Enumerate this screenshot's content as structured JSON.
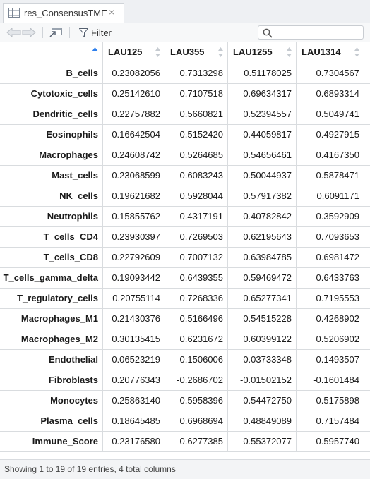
{
  "tab": {
    "title": "res_ConsensusTME",
    "close_glyph": "×"
  },
  "toolbar": {
    "filter_label": "Filter",
    "search_placeholder": ""
  },
  "table": {
    "columns": [
      "LAU125",
      "LAU355",
      "LAU1255",
      "LAU1314"
    ],
    "rows": [
      {
        "name": "B_cells",
        "values": [
          "0.23082056",
          "0.7313298",
          "0.51178025",
          "0.7304567"
        ]
      },
      {
        "name": "Cytotoxic_cells",
        "values": [
          "0.25142610",
          "0.7107518",
          "0.69634317",
          "0.6893314"
        ]
      },
      {
        "name": "Dendritic_cells",
        "values": [
          "0.22757882",
          "0.5660821",
          "0.52394557",
          "0.5049741"
        ]
      },
      {
        "name": "Eosinophils",
        "values": [
          "0.16642504",
          "0.5152420",
          "0.44059817",
          "0.4927915"
        ]
      },
      {
        "name": "Macrophages",
        "values": [
          "0.24608742",
          "0.5264685",
          "0.54656461",
          "0.4167350"
        ]
      },
      {
        "name": "Mast_cells",
        "values": [
          "0.23068599",
          "0.6083243",
          "0.50044937",
          "0.5878471"
        ]
      },
      {
        "name": "NK_cells",
        "values": [
          "0.19621682",
          "0.5928044",
          "0.57917382",
          "0.6091171"
        ]
      },
      {
        "name": "Neutrophils",
        "values": [
          "0.15855762",
          "0.4317191",
          "0.40782842",
          "0.3592909"
        ]
      },
      {
        "name": "T_cells_CD4",
        "values": [
          "0.23930397",
          "0.7269503",
          "0.62195643",
          "0.7093653"
        ]
      },
      {
        "name": "T_cells_CD8",
        "values": [
          "0.22792609",
          "0.7007132",
          "0.63984785",
          "0.6981472"
        ]
      },
      {
        "name": "T_cells_gamma_delta",
        "values": [
          "0.19093442",
          "0.6439355",
          "0.59469472",
          "0.6433763"
        ]
      },
      {
        "name": "T_regulatory_cells",
        "values": [
          "0.20755114",
          "0.7268336",
          "0.65277341",
          "0.7195553"
        ]
      },
      {
        "name": "Macrophages_M1",
        "values": [
          "0.21430376",
          "0.5166496",
          "0.54515228",
          "0.4268902"
        ]
      },
      {
        "name": "Macrophages_M2",
        "values": [
          "0.30135415",
          "0.6231672",
          "0.60399122",
          "0.5206902"
        ]
      },
      {
        "name": "Endothelial",
        "values": [
          "0.06523219",
          "0.1506006",
          "0.03733348",
          "0.1493507"
        ]
      },
      {
        "name": "Fibroblasts",
        "values": [
          "0.20776343",
          "-0.2686702",
          "-0.01502152",
          "-0.1601484"
        ]
      },
      {
        "name": "Monocytes",
        "values": [
          "0.25863140",
          "0.5958396",
          "0.54472750",
          "0.5175898"
        ]
      },
      {
        "name": "Plasma_cells",
        "values": [
          "0.18645485",
          "0.6968694",
          "0.48849089",
          "0.7157484"
        ]
      },
      {
        "name": "Immune_Score",
        "values": [
          "0.23176580",
          "0.6277385",
          "0.55372077",
          "0.5957740"
        ]
      }
    ]
  },
  "footer": {
    "status": "Showing 1 to 19 of 19 entries, 4 total columns"
  },
  "colors": {
    "accent": "#2f80ed",
    "border": "#d9dcdf",
    "toolbar_bg": "#f7f8f9"
  }
}
